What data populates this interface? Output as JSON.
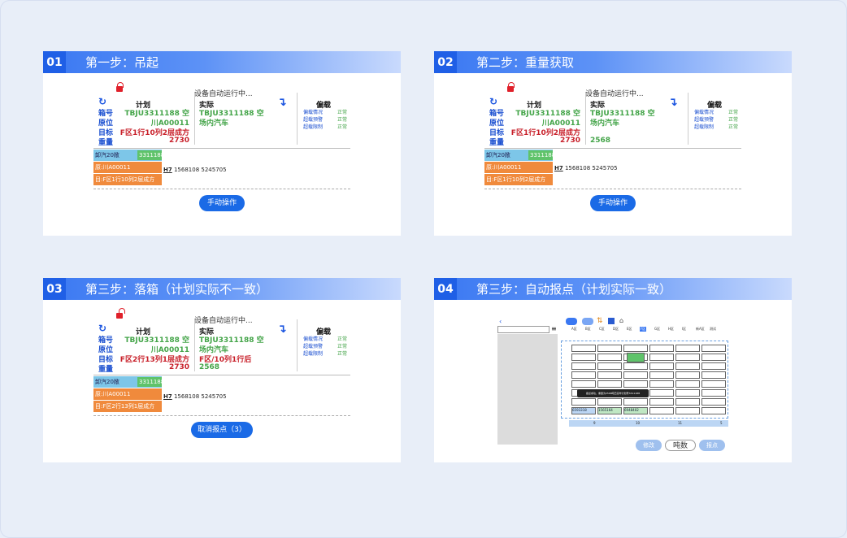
{
  "steps": [
    {
      "num": "01",
      "title": "第一步：吊起",
      "running": "设备自动运行中...",
      "plan_h": "计划",
      "actual_h": "实际",
      "warn_h": "偏载",
      "labels": [
        "箱号",
        "原位",
        "目标",
        "重量"
      ],
      "plan": [
        "TBJU3311188 空",
        "川A00011",
        "F区1行10列2层成方",
        "2730"
      ],
      "actual": [
        "TBJU3311188 空",
        "场内汽车",
        "",
        ""
      ],
      "warn_items": [
        "偏载情况",
        "超载预警",
        "超载限制"
      ],
      "warn_status": [
        "正常",
        "正常",
        "正常"
      ],
      "stack": [
        "卸汽20敞",
        "3311188",
        "原:川A00011",
        "目:F区1行10列2层成方"
      ],
      "h7": "H7",
      "h7a": "1568108",
      "h7b": "5245705",
      "button": "手动操作"
    },
    {
      "num": "02",
      "title": "第二步：重量获取",
      "running": "设备自动运行中...",
      "plan_h": "计划",
      "actual_h": "实际",
      "warn_h": "偏载",
      "labels": [
        "箱号",
        "原位",
        "目标",
        "重量"
      ],
      "plan": [
        "TBJU3311188 空",
        "川A00011",
        "F区1行10列2层成方",
        "2730"
      ],
      "actual": [
        "TBJU3311188 空",
        "场内汽车",
        "",
        "2568"
      ],
      "warn_items": [
        "偏载情况",
        "超载预警",
        "超载限制"
      ],
      "warn_status": [
        "正常",
        "正常",
        "正常"
      ],
      "stack": [
        "卸汽20敞",
        "3311188",
        "原:川A00011",
        "目:F区1行10列2层成方"
      ],
      "h7": "H7",
      "h7a": "1568108",
      "h7b": "5245705",
      "button": "手动操作"
    },
    {
      "num": "03",
      "title": "第三步：落箱（计划实际不一致）",
      "running": "设备自动运行中...",
      "plan_h": "计划",
      "actual_h": "实际",
      "warn_h": "偏载",
      "labels": [
        "箱号",
        "原位",
        "目标",
        "重量"
      ],
      "plan": [
        "TBJU3311188 空",
        "川A00011",
        "F区2行13列1层成方",
        "2730"
      ],
      "actual": [
        "TBJU3311188 空",
        "场内汽车",
        "F区/10列1行后",
        "2568"
      ],
      "warn_items": [
        "偏载情况",
        "超载预警",
        "超载限制"
      ],
      "warn_status": [
        "正常",
        "正常",
        "正常"
      ],
      "stack": [
        "卸汽20敞",
        "3311188",
        "原:川A00011",
        "目:F区2行13列1层成方"
      ],
      "h7": "H7",
      "h7a": "1568108",
      "h7b": "5245705",
      "button": "取消报点（3）"
    },
    {
      "num": "04",
      "title": "第三步：自动报点（计划实际一致）",
      "tabs": [
        "A区",
        "B区",
        "C区",
        "D区",
        "E区",
        "F区",
        "G区",
        "H区",
        "I区",
        "新A区",
        "测试"
      ],
      "cols": [
        "9",
        "10",
        "11",
        "5"
      ],
      "popup": "报点成功，重量为2568吨已完毕计划号3311188",
      "cells": [
        "6593318",
        "1565164",
        "6948402"
      ],
      "buttons": [
        "修改",
        "吨数",
        "报点"
      ]
    }
  ]
}
